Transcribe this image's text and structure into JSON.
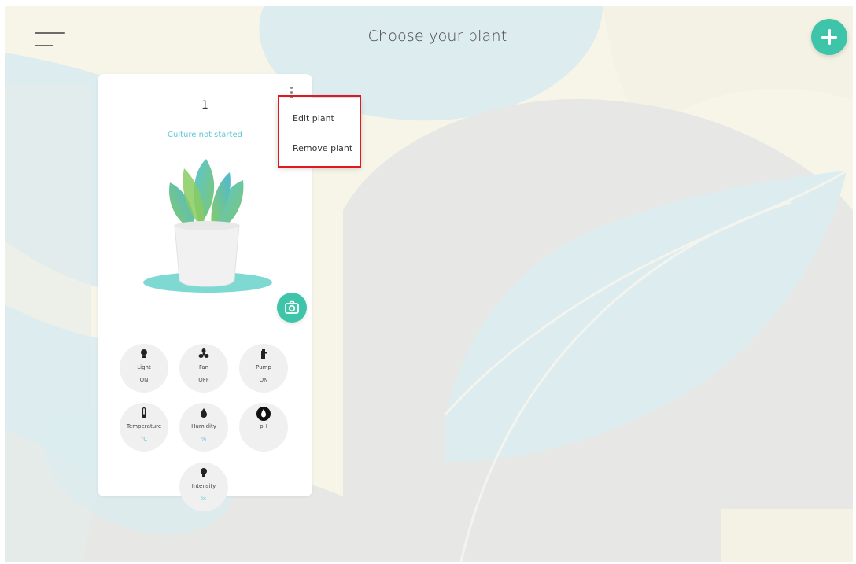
{
  "header": {
    "title": "Choose your plant"
  },
  "plant_card": {
    "name": "1",
    "status": "Culture not started",
    "sensors": [
      {
        "label": "Light",
        "value": "ON",
        "icon": "bulb-icon"
      },
      {
        "label": "Fan",
        "value": "OFF",
        "icon": "fan-icon"
      },
      {
        "label": "Pump",
        "value": "ON",
        "icon": "pump-icon"
      },
      {
        "label": "Temperature",
        "value": "°C",
        "icon": "thermometer-icon"
      },
      {
        "label": "Humidity",
        "value": "%",
        "icon": "droplet-icon"
      },
      {
        "label": "pH",
        "value": "",
        "icon": "ph-drop-icon"
      },
      {
        "label": "Intensity",
        "value": "lx",
        "icon": "bulb-icon"
      }
    ]
  },
  "context_menu": {
    "items": [
      "Edit plant",
      "Remove plant"
    ]
  },
  "colors": {
    "accent": "#3ec4a8",
    "status_text": "#5fc8d8",
    "highlight": "#e0191e"
  }
}
